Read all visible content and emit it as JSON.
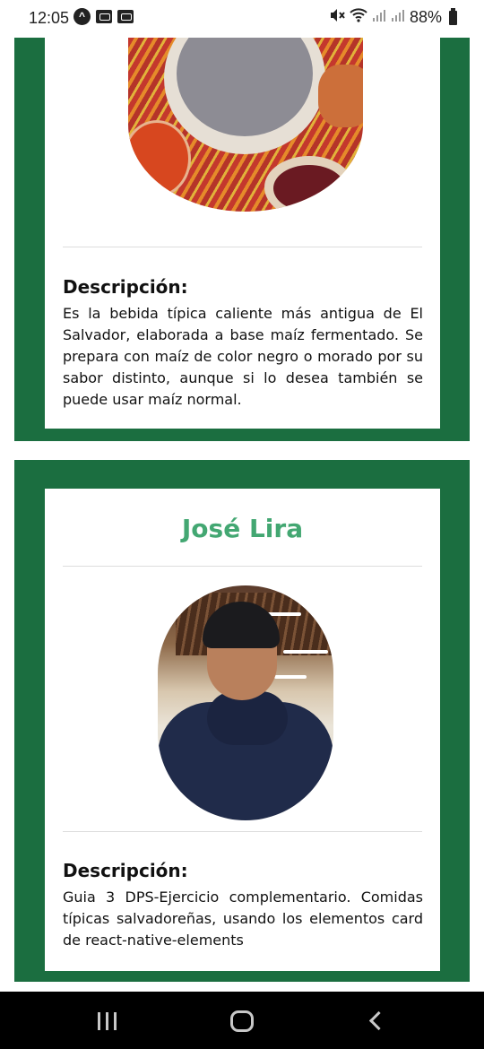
{
  "status_bar": {
    "time": "12:05",
    "battery": "88%",
    "icons": [
      "app-indicator-icon",
      "voicemail-icon",
      "voicemail-icon",
      "mute-icon",
      "wifi-icon",
      "signal-icon",
      "signal-icon",
      "battery-icon"
    ]
  },
  "card1": {
    "description_title": "Descripción:",
    "description_text": "Es la bebida típica caliente más antigua de El Salvador, elaborada a base maíz fermentado. Se prepara con maíz de color negro o morado por su sabor distinto, aunque si lo desea también se puede usar maíz normal."
  },
  "card2": {
    "name": "José Lira",
    "description_title": "Descripción:",
    "description_text": "Guia 3 DPS-Ejercicio complementario. Comidas típicas salvadoreñas, usando los elementos card de react-native-elements"
  },
  "colors": {
    "card_border": "#1b6e40",
    "name_accent": "#43a772"
  },
  "navbar": {
    "buttons": [
      "recent-apps",
      "home",
      "back"
    ]
  }
}
